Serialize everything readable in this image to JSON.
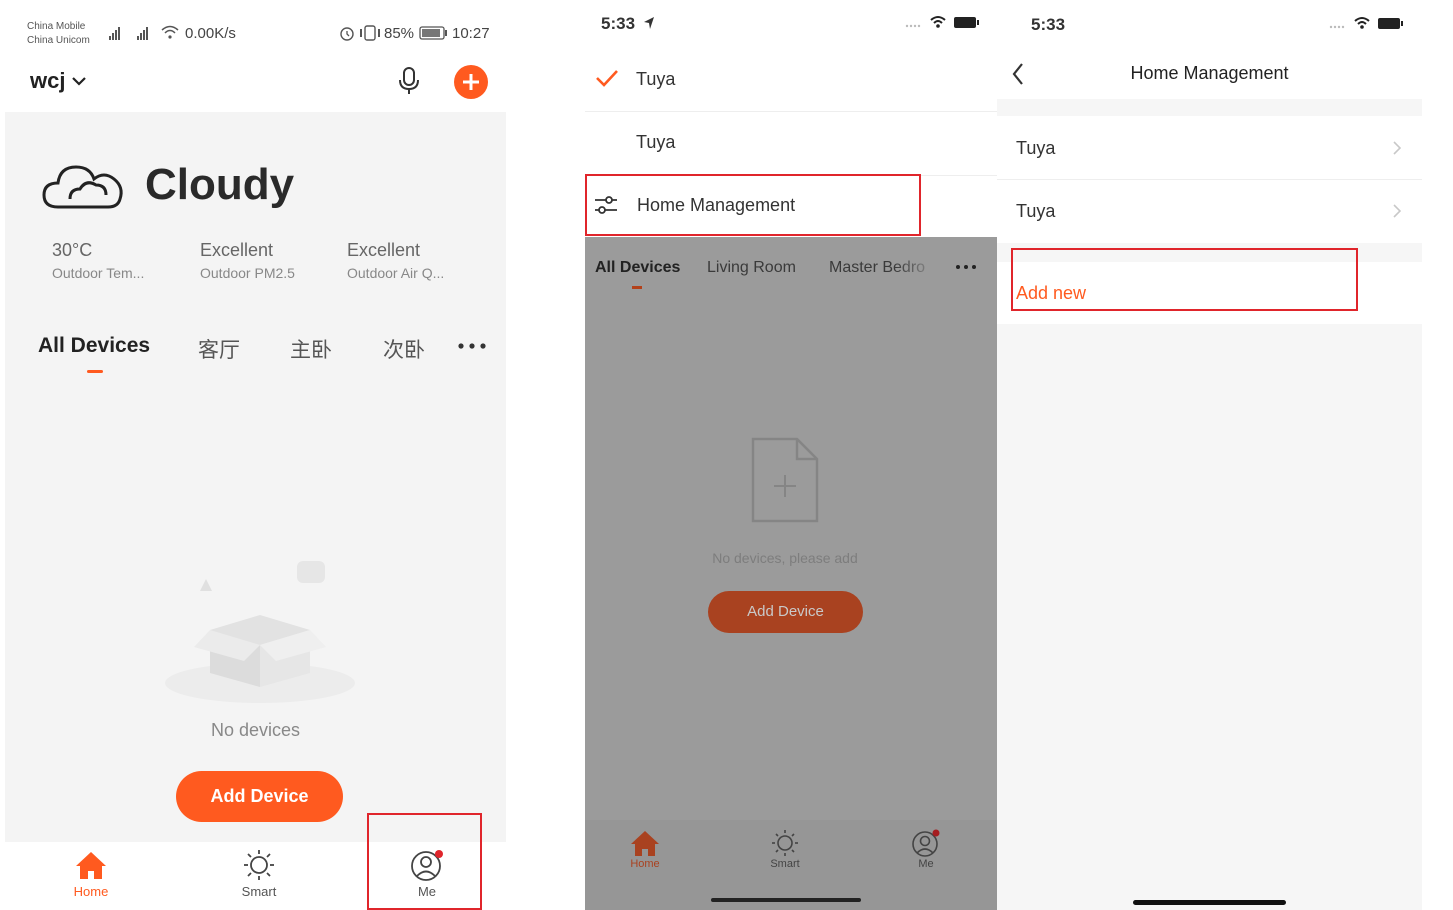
{
  "panel1": {
    "status_bar": {
      "carrier_1": "China Mobile",
      "carrier_2": "China Unicom",
      "net_speed": "0.00K/s",
      "battery": "85%",
      "time": "10:27"
    },
    "header": {
      "home_name": "wcj"
    },
    "weather": {
      "condition": "Cloudy",
      "stats": [
        {
          "value": "30°C",
          "label": "Outdoor Tem..."
        },
        {
          "value": "Excellent",
          "label": "Outdoor PM2.5"
        },
        {
          "value": "Excellent",
          "label": "Outdoor Air Q..."
        }
      ]
    },
    "tabs": [
      "All Devices",
      "客厅",
      "主卧",
      "次卧"
    ],
    "empty_text": "No devices",
    "add_device_label": "Add Device",
    "nav": [
      "Home",
      "Smart",
      "Me"
    ]
  },
  "panel2": {
    "status_time": "5:33",
    "menu": [
      "Tuya",
      "Tuya",
      "Home Management"
    ],
    "tabs": [
      "All Devices",
      "Living Room",
      "Master Bedro"
    ],
    "empty_text": "No devices, please add",
    "add_device_label": "Add Device",
    "nav": [
      "Home",
      "Smart",
      "Me"
    ]
  },
  "panel3": {
    "status_time": "5:33",
    "title": "Home Management",
    "rows": [
      "Tuya",
      "Tuya"
    ],
    "add_new": "Add new"
  },
  "colors": {
    "accent": "#ff5a1f",
    "highlight": "#e0252b"
  }
}
